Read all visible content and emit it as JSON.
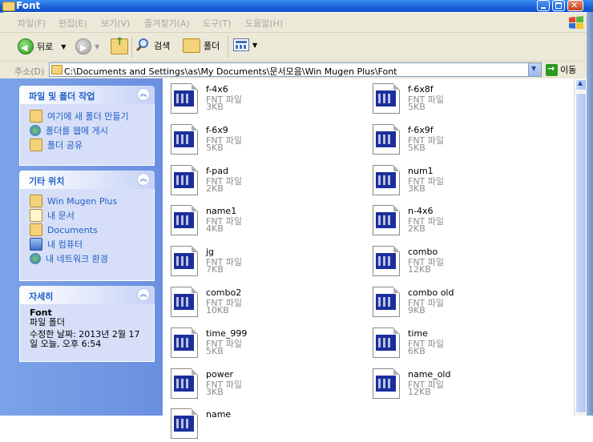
{
  "window": {
    "title": "Font"
  },
  "menu": [
    "파일(F)",
    "편집(E)",
    "보기(V)",
    "즐겨찾기(A)",
    "도구(T)",
    "도움말(H)"
  ],
  "toolbar": {
    "back": "뒤로",
    "search": "검색",
    "folders": "폴더"
  },
  "address": {
    "label": "주소(D)",
    "path": "C:\\Documents and Settings\\as\\My Documents\\문서모음\\Win Mugen Plus\\Font",
    "go": "이동"
  },
  "tasks": {
    "title": "파일 및 폴더 작업",
    "items": [
      "여기에 새 폴더 만들기",
      "폴더를 웹에 게시",
      "폴더 공유"
    ]
  },
  "other_places": {
    "title": "기타 위치",
    "items": [
      "Win Mugen Plus",
      "내 문서",
      "Documents",
      "내 컴퓨터",
      "내 네트워크 환경"
    ]
  },
  "details": {
    "title": "자세히",
    "name": "Font",
    "type": "파일 폴더",
    "modified1": "수정한 날짜: 2013년 2월 17",
    "modified2": "일 오늘, 오후 6:54"
  },
  "files": [
    {
      "name": "f-4x6",
      "type": "FNT 파일",
      "size": "3KB"
    },
    {
      "name": "f-6x8f",
      "type": "FNT 파일",
      "size": "5KB"
    },
    {
      "name": "f-6x9",
      "type": "FNT 파일",
      "size": "5KB"
    },
    {
      "name": "f-6x9f",
      "type": "FNT 파일",
      "size": "5KB"
    },
    {
      "name": "f-pad",
      "type": "FNT 파일",
      "size": "2KB"
    },
    {
      "name": "num1",
      "type": "FNT 파일",
      "size": "3KB"
    },
    {
      "name": "name1",
      "type": "FNT 파일",
      "size": "4KB"
    },
    {
      "name": "n-4x6",
      "type": "FNT 파일",
      "size": "2KB"
    },
    {
      "name": "jg",
      "type": "FNT 파일",
      "size": "7KB"
    },
    {
      "name": "combo",
      "type": "FNT 파일",
      "size": "12KB"
    },
    {
      "name": "combo2",
      "type": "FNT 파일",
      "size": "10KB"
    },
    {
      "name": "combo old",
      "type": "FNT 파일",
      "size": "9KB"
    },
    {
      "name": "time_999",
      "type": "FNT 파일",
      "size": "5KB"
    },
    {
      "name": "time",
      "type": "FNT 파일",
      "size": "6KB"
    },
    {
      "name": "power",
      "type": "FNT 파일",
      "size": "3KB"
    },
    {
      "name": "name_old",
      "type": "FNT 파일",
      "size": "12KB"
    },
    {
      "name": "name",
      "type": "",
      "size": ""
    }
  ]
}
